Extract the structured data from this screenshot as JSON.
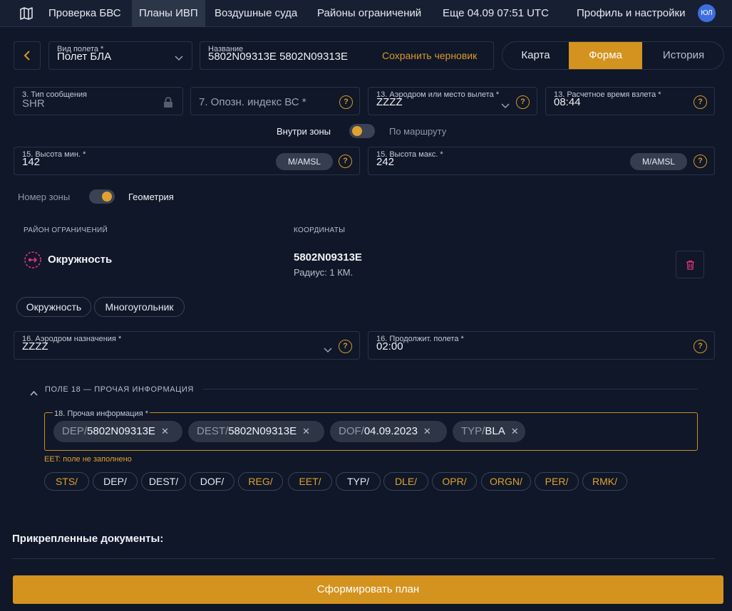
{
  "nav": {
    "items": [
      "Проверка БВС",
      "Планы ИВП",
      "Воздушные суда",
      "Районы ограничений",
      "Еще 04.09 07:51 UTC",
      "Профиль и настройки"
    ],
    "avatar": "ЮЛ"
  },
  "header": {
    "flight_type_label": "Вид полета *",
    "flight_type_value": "Полет БЛА",
    "name_label": "Название",
    "name_value": "5802N09313E 5802N09313E",
    "save_draft": "Сохранить черновик",
    "tabs": [
      "Карта",
      "Форма",
      "История"
    ],
    "active_tab": "Форма"
  },
  "row1": {
    "msg_type_label": "3. Тип сообщения",
    "msg_type_value": "SHR",
    "aircraft_id_placeholder": "7. Опозн. индекс ВС *",
    "dep_aerodrome_label": "13. Аэродром или место вылета *",
    "dep_aerodrome_value": "ZZZZ",
    "dep_time_label": "13. Расчетное время взлета *",
    "dep_time_value": "08:44"
  },
  "zone_toggle": {
    "left": "Внутри зоны",
    "right": "По маршруту"
  },
  "altitude": {
    "min_label": "15. Высота мин. *",
    "min_value": "142",
    "max_label": "15. Высота макс. *",
    "max_value": "242",
    "unit": "M/AMSL"
  },
  "geometry_toggle": {
    "left": "Номер зоны",
    "right": "Геометрия"
  },
  "restrictions": {
    "col_area": "РАЙОН ОГРАНИЧЕНИЙ",
    "col_coords": "КООРДИНАТЫ",
    "area_name": "Окружность",
    "coords": "5802N09313E",
    "radius": "Радиус: 1 КМ.",
    "shape_buttons": [
      "Окружность",
      "Многоугольник"
    ]
  },
  "row_dest": {
    "dest_label": "16. Аэродром назначения *",
    "dest_value": "ZZZZ",
    "duration_label": "16. Продолжит. полета *",
    "duration_value": "02:00"
  },
  "field18": {
    "section_title": "ПОЛЕ 18 — ПРОЧАЯ ИНФОРМАЦИЯ",
    "label": "18. Прочая информация *",
    "chips": [
      {
        "key": "DEP/",
        "value": "5802N09313E"
      },
      {
        "key": "DEST/",
        "value": "5802N09313E"
      },
      {
        "key": "DOF/",
        "value": "04.09.2023"
      },
      {
        "key": "TYP/",
        "value": "BLA"
      }
    ],
    "error": "EET: поле не заполнено",
    "tags": [
      {
        "label": "STS/",
        "color": "#e0a130"
      },
      {
        "label": "DEP/",
        "color": "#e6e9ef"
      },
      {
        "label": "DEST/",
        "color": "#e6e9ef"
      },
      {
        "label": "DOF/",
        "color": "#e6e9ef"
      },
      {
        "label": "REG/",
        "color": "#e0a130"
      },
      {
        "label": "EET/",
        "color": "#e0a130"
      },
      {
        "label": "TYP/",
        "color": "#e6e9ef"
      },
      {
        "label": "DLE/",
        "color": "#e0a130"
      },
      {
        "label": "OPR/",
        "color": "#e0a130"
      },
      {
        "label": "ORGN/",
        "color": "#e0a130"
      },
      {
        "label": "PER/",
        "color": "#e0a130"
      },
      {
        "label": "RMK/",
        "color": "#e0a130"
      }
    ]
  },
  "documents_title": "Прикрепленные документы:",
  "submit_label": "Сформировать план",
  "colors": {
    "accent": "#d4931f",
    "background": "#0f1728",
    "error": "#e0a130",
    "circle_icon": "#e0357a"
  }
}
